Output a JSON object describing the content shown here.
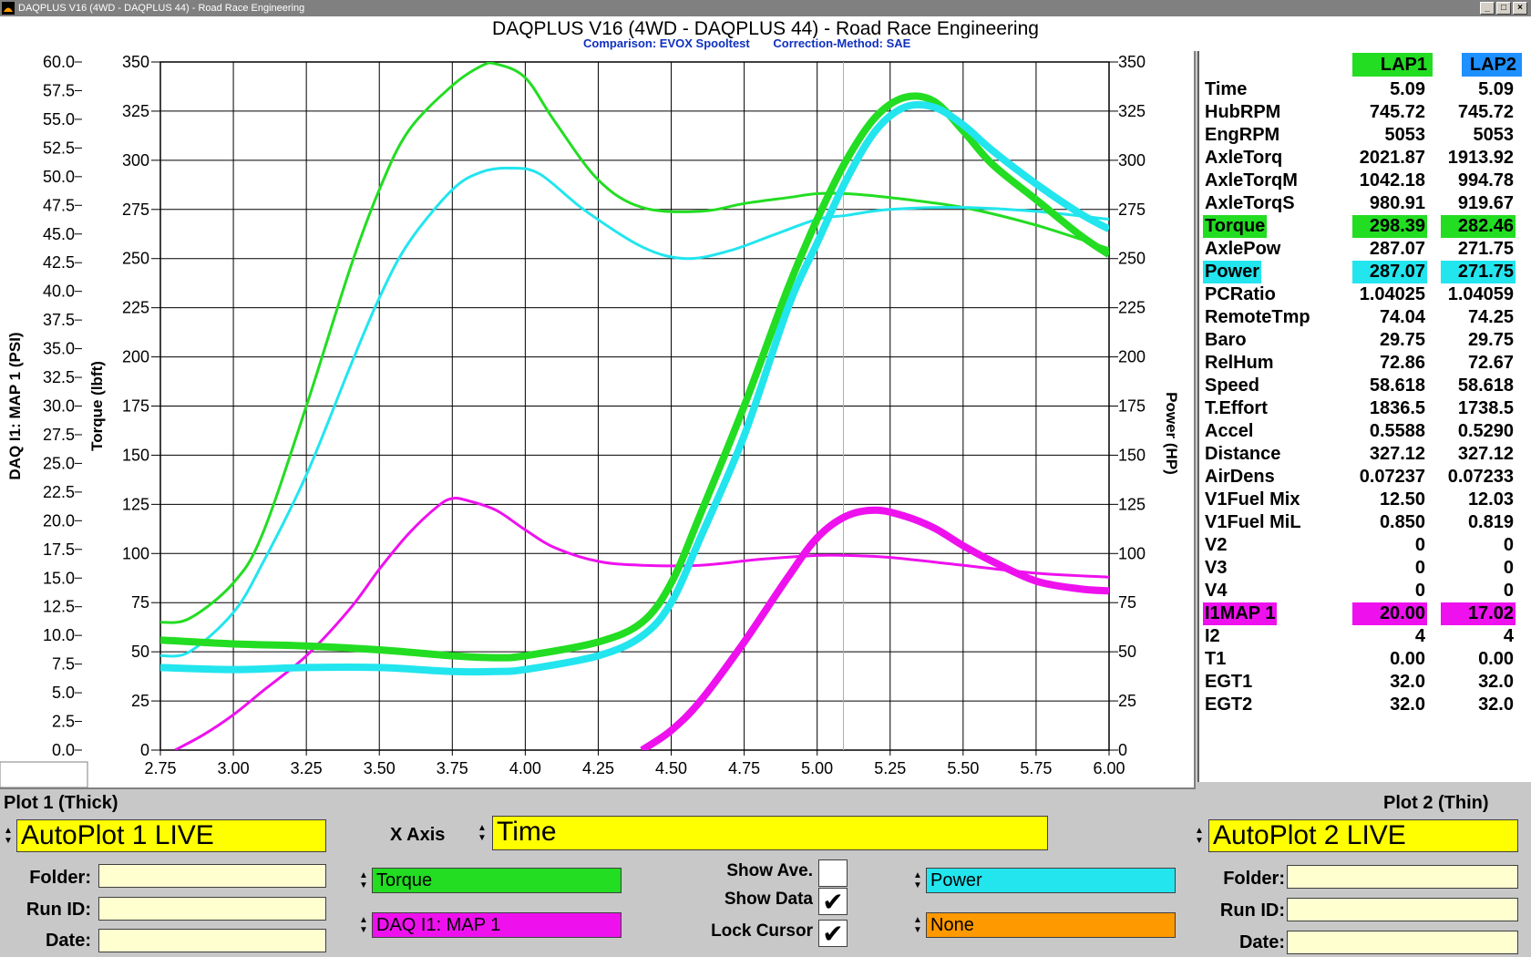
{
  "window": {
    "title": "DAQPLUS V16 (4WD - DAQPLUS 44) - Road Race Engineering",
    "buttons": [
      "_",
      "□",
      "×"
    ]
  },
  "header": {
    "title": "DAQPLUS V16 (4WD - DAQPLUS 44) - Road Race Engineering",
    "comparison": "Comparison: EVOX Spooltest",
    "correction": "Correction-Method: SAE"
  },
  "chart_data": {
    "type": "line",
    "xlabel": "",
    "x_ticks": [
      "2.75",
      "3.00",
      "3.25",
      "3.50",
      "3.75",
      "4.00",
      "4.25",
      "4.50",
      "4.75",
      "5.00",
      "5.25",
      "5.50",
      "5.75",
      "6.00"
    ],
    "xlim": [
      2.75,
      6.0
    ],
    "y_left_outer_label": "DAQ I1: MAP 1 (PSI)",
    "y_left_outer_ticks": [
      "60.0",
      "57.5",
      "55.0",
      "52.5",
      "50.0",
      "47.5",
      "45.0",
      "42.5",
      "40.0",
      "37.5",
      "35.0",
      "32.5",
      "30.0",
      "27.5",
      "25.0",
      "22.5",
      "20.0",
      "17.5",
      "15.0",
      "12.5",
      "10.0",
      "7.5",
      "5.0",
      "2.5",
      "0.0"
    ],
    "y_left_outer_lim": [
      0,
      60
    ],
    "y_left_inner_label": "Torque (lbft)",
    "y_left_inner_ticks": [
      "350",
      "325",
      "300",
      "275",
      "250",
      "225",
      "200",
      "175",
      "150",
      "125",
      "100",
      "75",
      "50",
      "25",
      "0"
    ],
    "y_left_inner_lim": [
      0,
      350
    ],
    "y_right_label": "Power (HP)",
    "y_right_ticks": [
      "350",
      "325",
      "300",
      "275",
      "250",
      "225",
      "200",
      "175",
      "150",
      "125",
      "100",
      "75",
      "50",
      "25",
      "0"
    ],
    "y_right_lim": [
      0,
      350
    ],
    "cursor_x": 5.09,
    "grid": true,
    "series": [
      {
        "color": "#22dd22",
        "width": 8,
        "axis": "inner",
        "x": [
          2.75,
          3.0,
          3.25,
          3.5,
          3.75,
          3.9,
          4.0,
          4.25,
          4.4,
          4.5,
          4.6,
          4.75,
          4.9,
          5.0,
          5.1,
          5.2,
          5.3,
          5.4,
          5.5,
          5.6,
          5.75,
          5.9,
          6.0
        ],
        "y": [
          56,
          54,
          53,
          51,
          48,
          47,
          48,
          55,
          65,
          85,
          120,
          175,
          235,
          270,
          300,
          322,
          332,
          330,
          315,
          298,
          280,
          262,
          252
        ]
      },
      {
        "color": "#22dd22",
        "width": 3,
        "axis": "inner",
        "x": [
          2.75,
          2.85,
          3.0,
          3.1,
          3.25,
          3.4,
          3.5,
          3.6,
          3.75,
          3.85,
          3.9,
          4.0,
          4.1,
          4.25,
          4.4,
          4.6,
          4.75,
          4.9,
          5.0,
          5.1,
          5.25,
          5.5,
          5.75,
          6.0
        ],
        "y": [
          65,
          67,
          85,
          110,
          175,
          245,
          285,
          315,
          338,
          348,
          349,
          342,
          320,
          290,
          276,
          274,
          278,
          281,
          283,
          283,
          281,
          276,
          267,
          255
        ]
      },
      {
        "color": "#22e5ee",
        "width": 8,
        "axis": "right",
        "x": [
          2.75,
          3.0,
          3.25,
          3.5,
          3.75,
          3.9,
          4.0,
          4.25,
          4.4,
          4.5,
          4.6,
          4.75,
          4.9,
          5.0,
          5.1,
          5.2,
          5.3,
          5.4,
          5.5,
          5.6,
          5.75,
          5.9,
          6.0
        ],
        "y": [
          42,
          41,
          42,
          42,
          40,
          40,
          41,
          48,
          58,
          75,
          108,
          160,
          225,
          258,
          290,
          315,
          327,
          327,
          318,
          305,
          288,
          273,
          265
        ]
      },
      {
        "color": "#22e5ee",
        "width": 3,
        "axis": "right",
        "x": [
          2.75,
          2.85,
          3.0,
          3.1,
          3.25,
          3.4,
          3.5,
          3.6,
          3.75,
          3.85,
          3.95,
          4.05,
          4.2,
          4.4,
          4.55,
          4.7,
          4.85,
          5.0,
          5.1,
          5.25,
          5.5,
          5.75,
          6.0
        ],
        "y": [
          48,
          50,
          70,
          95,
          140,
          195,
          230,
          258,
          285,
          294,
          296,
          293,
          275,
          256,
          250,
          254,
          262,
          270,
          272,
          275,
          276,
          274,
          270
        ]
      },
      {
        "color": "#ee11ee",
        "width": 8,
        "axis": "inner",
        "x": [
          4.4,
          4.5,
          4.6,
          4.75,
          4.9,
          5.0,
          5.1,
          5.2,
          5.3,
          5.4,
          5.5,
          5.6,
          5.75,
          5.9,
          6.0
        ],
        "y": [
          0,
          10,
          25,
          55,
          88,
          108,
          119,
          122,
          119,
          113,
          104,
          96,
          86,
          82,
          81
        ]
      },
      {
        "color": "#ee11ee",
        "width": 3,
        "axis": "inner",
        "x": [
          2.8,
          2.9,
          3.0,
          3.1,
          3.25,
          3.4,
          3.5,
          3.6,
          3.7,
          3.75,
          3.8,
          3.9,
          4.0,
          4.1,
          4.25,
          4.4,
          4.6,
          4.8,
          5.0,
          5.1,
          5.25,
          5.5,
          5.75,
          6.0
        ],
        "y": [
          0,
          8,
          18,
          30,
          48,
          72,
          92,
          110,
          124,
          128,
          127,
          122,
          112,
          103,
          96,
          94,
          94,
          97,
          99,
          99,
          98,
          94,
          90,
          88
        ]
      }
    ]
  },
  "data_panel": {
    "col1": "LAP1",
    "col2": "LAP2",
    "rows": [
      {
        "label": "Time",
        "v1": "5.09",
        "v2": "5.09",
        "hl": ""
      },
      {
        "label": "HubRPM",
        "v1": "745.72",
        "v2": "745.72",
        "hl": ""
      },
      {
        "label": "EngRPM",
        "v1": "5053",
        "v2": "5053",
        "hl": ""
      },
      {
        "label": "AxleTorq",
        "v1": "2021.87",
        "v2": "1913.92",
        "hl": ""
      },
      {
        "label": "AxleTorqM",
        "v1": "1042.18",
        "v2": "994.78",
        "hl": ""
      },
      {
        "label": "AxleTorqS",
        "v1": "980.91",
        "v2": "919.67",
        "hl": ""
      },
      {
        "label": "Torque",
        "v1": "298.39",
        "v2": "282.46",
        "hl": "#22dd22"
      },
      {
        "label": "AxlePow",
        "v1": "287.07",
        "v2": "271.75",
        "hl": ""
      },
      {
        "label": "Power",
        "v1": "287.07",
        "v2": "271.75",
        "hl": "#22e5ee"
      },
      {
        "label": "PCRatio",
        "v1": "1.04025",
        "v2": "1.04059",
        "hl": ""
      },
      {
        "label": "RemoteTmp",
        "v1": "74.04",
        "v2": "74.25",
        "hl": ""
      },
      {
        "label": "Baro",
        "v1": "29.75",
        "v2": "29.75",
        "hl": ""
      },
      {
        "label": "RelHum",
        "v1": "72.86",
        "v2": "72.67",
        "hl": ""
      },
      {
        "label": "Speed",
        "v1": "58.618",
        "v2": "58.618",
        "hl": ""
      },
      {
        "label": "T.Effort",
        "v1": "1836.5",
        "v2": "1738.5",
        "hl": ""
      },
      {
        "label": "Accel",
        "v1": "0.5588",
        "v2": "0.5290",
        "hl": ""
      },
      {
        "label": "Distance",
        "v1": "327.12",
        "v2": "327.12",
        "hl": ""
      },
      {
        "label": "AirDens",
        "v1": "0.07237",
        "v2": "0.07233",
        "hl": ""
      },
      {
        "label": "V1Fuel Mix",
        "v1": "12.50",
        "v2": "12.03",
        "hl": ""
      },
      {
        "label": "V1Fuel MiL",
        "v1": "0.850",
        "v2": "0.819",
        "hl": ""
      },
      {
        "label": "V2",
        "v1": "0",
        "v2": "0",
        "hl": ""
      },
      {
        "label": "V3",
        "v1": "0",
        "v2": "0",
        "hl": ""
      },
      {
        "label": "V4",
        "v1": "0",
        "v2": "0",
        "hl": ""
      },
      {
        "label": "I1MAP 1",
        "v1": "20.00",
        "v2": "17.02",
        "hl": "#ee11ee"
      },
      {
        "label": "I2",
        "v1": "4",
        "v2": "4",
        "hl": ""
      },
      {
        "label": "T1",
        "v1": "0.00",
        "v2": "0.00",
        "hl": ""
      },
      {
        "label": "EGT1",
        "v1": "32.0",
        "v2": "32.0",
        "hl": ""
      },
      {
        "label": "EGT2",
        "v1": "32.0",
        "v2": "32.0",
        "hl": ""
      }
    ]
  },
  "controls": {
    "plot1_label": "Plot 1 (Thick)",
    "plot2_label": "Plot 2 (Thin)",
    "plot1_select": "AutoPlot 1 LIVE",
    "plot2_select": "AutoPlot 2 LIVE",
    "xaxis_label": "X Axis",
    "xaxis_value": "Time",
    "folder_label": "Folder:",
    "runid_label": "Run ID:",
    "date_label": "Date:",
    "channel1": "Torque",
    "channel2": "DAQ I1: MAP 1",
    "channel3": "Power",
    "channel4": "None",
    "show_ave": "Show Ave.",
    "show_data": "Show Data",
    "lock_cursor": "Lock Cursor",
    "show_ave_checked": false,
    "show_data_checked": true,
    "lock_cursor_checked": true,
    "colors": {
      "yellow": "#ffff00",
      "pale_yellow": "#ffffd0",
      "green": "#22dd22",
      "cyan": "#22e5ee",
      "magenta": "#ee11ee",
      "orange": "#ff9900"
    }
  }
}
